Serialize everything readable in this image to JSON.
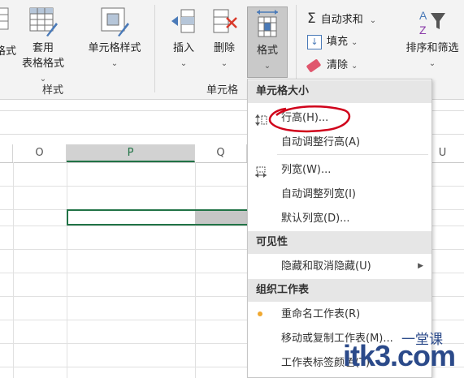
{
  "ribbon": {
    "partial_left_label": "格式",
    "apply_table_style_line1": "套用",
    "apply_table_style_line2": "表格格式",
    "cell_style_label": "单元格样式",
    "styles_group_label": "样式",
    "insert_label": "插入",
    "delete_label": "删除",
    "format_label": "格式",
    "cells_group_label": "单元格",
    "autosum_label": "自动求和",
    "fill_label": "填充",
    "clear_label": "清除",
    "sort_filter_label": "排序和筛选",
    "chevron": "⌄",
    "accent": "#217346"
  },
  "columns": [
    "O",
    "P",
    "Q",
    "U"
  ],
  "format_menu": {
    "section_cell_size": "单元格大小",
    "row_height": "行高(H)...",
    "autofit_row_height": "自动调整行高(A)",
    "column_width": "列宽(W)...",
    "autofit_column_width": "自动调整列宽(I)",
    "default_width": "默认列宽(D)...",
    "section_visibility": "可见性",
    "hide_unhide": "隐藏和取消隐藏(U)",
    "section_organize": "组织工作表",
    "rename_sheet": "重命名工作表(R)",
    "move_copy_sheet": "移动或复制工作表(M)...",
    "tab_color": "工作表标签颜色(T)"
  },
  "watermark": "itk3.com",
  "watermark_cn": "一堂课",
  "annotation_color": "#d0021b"
}
